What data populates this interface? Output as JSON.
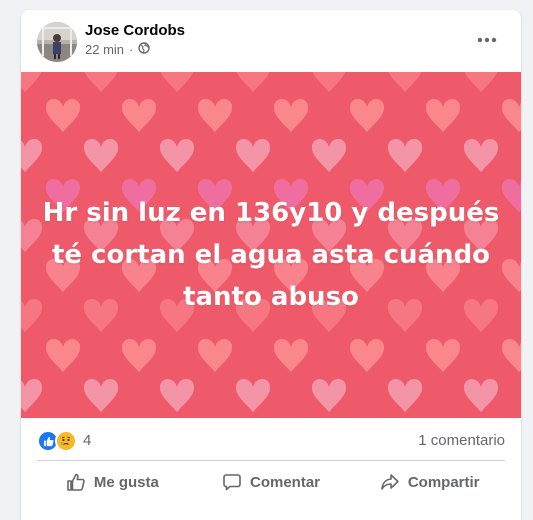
{
  "post": {
    "author": "Jose Cordobs",
    "time": "22 min",
    "separator": "·",
    "privacy_icon": "globe-icon",
    "menu_icon": "more-options-icon",
    "background_theme": "hearts",
    "background_color": "#ef5a6a",
    "text_lines": [
      "Hr sin luz en 136y10 y después",
      "té cortan el agua asta cuándo",
      "tanto abuso"
    ]
  },
  "reactions": {
    "icons": [
      "like-reaction-icon",
      "sad-reaction-icon"
    ],
    "count": "4",
    "comments": "1 comentario"
  },
  "actions": {
    "like": "Me gusta",
    "comment": "Comentar",
    "share": "Compartir"
  },
  "colors": {
    "like_blue": "#1877f2",
    "sad_yellow": "#f7b928",
    "muted_text": "#65676b"
  }
}
